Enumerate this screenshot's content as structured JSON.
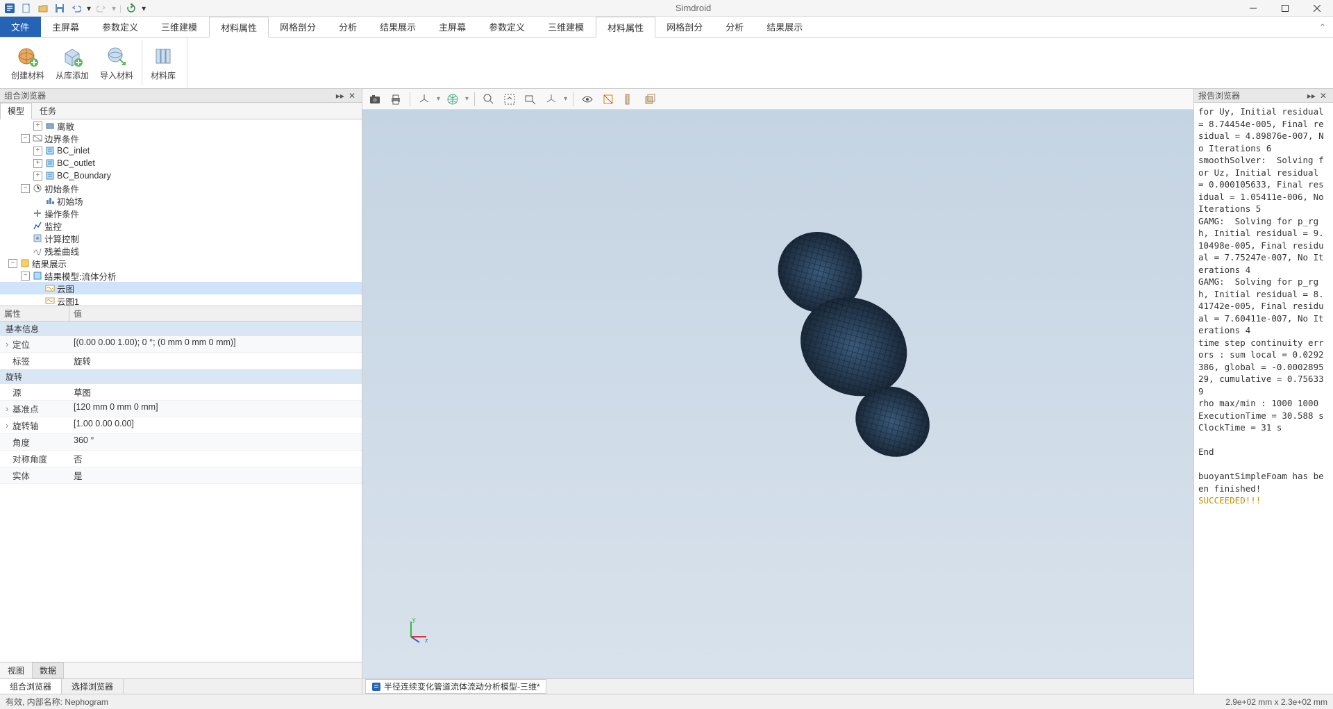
{
  "title": "Simdroid",
  "menu": {
    "file": "文件",
    "tabs": [
      "主屏幕",
      "参数定义",
      "三维建模",
      "材料属性",
      "网格剖分",
      "分析",
      "结果展示"
    ],
    "active_index": 3
  },
  "ribbon": {
    "buttons": [
      {
        "label": "创建材料",
        "icon": "sphere-plus"
      },
      {
        "label": "从库添加",
        "icon": "cube-plus"
      },
      {
        "label": "导入材料",
        "icon": "sphere-import"
      },
      {
        "label": "材料库",
        "icon": "library"
      }
    ]
  },
  "left": {
    "pane_title": "组合浏览器",
    "tree_tabs": [
      "模型",
      "任务"
    ],
    "tree_active": 0,
    "tree": [
      {
        "indent": 1,
        "toggle": "+",
        "icon": "node-blue",
        "label": "离散"
      },
      {
        "indent": 0,
        "toggle": "-",
        "icon": "boundary",
        "label": "边界条件"
      },
      {
        "indent": 1,
        "toggle": "+",
        "icon": "bc",
        "label": "BC_inlet"
      },
      {
        "indent": 1,
        "toggle": "+",
        "icon": "bc",
        "label": "BC_outlet"
      },
      {
        "indent": 1,
        "toggle": "+",
        "icon": "bc",
        "label": "BC_Boundary"
      },
      {
        "indent": 0,
        "toggle": "-",
        "icon": "init",
        "label": "初始条件"
      },
      {
        "indent": 1,
        "toggle": "",
        "icon": "field",
        "label": "初始场"
      },
      {
        "indent": 0,
        "toggle": "",
        "icon": "op",
        "label": "操作条件"
      },
      {
        "indent": 0,
        "toggle": "",
        "icon": "monitor",
        "label": "监控"
      },
      {
        "indent": 0,
        "toggle": "",
        "icon": "control",
        "label": "计算控制"
      },
      {
        "indent": 0,
        "toggle": "",
        "icon": "curve",
        "label": "残差曲线"
      },
      {
        "indent": -1,
        "toggle": "-",
        "icon": "result",
        "label": "结果展示"
      },
      {
        "indent": 0,
        "toggle": "-",
        "icon": "result-model",
        "label": "结果模型:流体分析"
      },
      {
        "indent": 1,
        "toggle": "",
        "icon": "cloud",
        "label": "云图",
        "selected": true
      },
      {
        "indent": 1,
        "toggle": "",
        "icon": "cloud",
        "label": "云图1"
      }
    ],
    "prop_header": [
      "属性",
      "值"
    ],
    "prop_sections": [
      {
        "title": "基本信息",
        "rows": [
          {
            "k": "定位",
            "v": "[(0.00 0.00 1.00); 0 °; (0 mm  0 mm  0 mm)]",
            "exp": true
          },
          {
            "k": "标签",
            "v": "旋转"
          }
        ]
      },
      {
        "title": "旋转",
        "rows": [
          {
            "k": "源",
            "v": "草图"
          },
          {
            "k": "基准点",
            "v": "[120 mm  0 mm  0 mm]",
            "exp": true
          },
          {
            "k": "旋转轴",
            "v": "[1.00 0.00 0.00]",
            "exp": true
          },
          {
            "k": "角度",
            "v": "360 °"
          },
          {
            "k": "对称角度",
            "v": "否"
          },
          {
            "k": "实体",
            "v": "是"
          }
        ]
      }
    ],
    "bottom_tabs1": [
      "视图",
      "数据"
    ],
    "bottom_tabs1_active": 1,
    "bottom_tabs2": [
      "组合浏览器",
      "选择浏览器"
    ],
    "bottom_tabs2_active": 0
  },
  "center": {
    "doc_tab": "半径连续变化管道流体流动分析模型-三维*"
  },
  "right": {
    "pane_title": "报告浏览器",
    "log_text": "for Uy, Initial residual = 8.74454e-005, Final residual = 4.89876e-007, No Iterations 6\nsmoothSolver:  Solving for Uz, Initial residual = 0.000105633, Final residual = 1.05411e-006, No Iterations 5\nGAMG:  Solving for p_rgh, Initial residual = 9.10498e-005, Final residual = 7.75247e-007, No Iterations 4\nGAMG:  Solving for p_rgh, Initial residual = 8.41742e-005, Final residual = 7.60411e-007, No Iterations 4\ntime step continuity errors : sum local = 0.0292386, global = -0.000289529, cumulative = 0.756339\nrho max/min : 1000 1000\nExecutionTime = 30.588 s  ClockTime = 31 s\n\nEnd\n\nbuoyantSimpleFoam has been finished!",
    "log_success": "SUCCEEDED!!!"
  },
  "status": {
    "left": "有效, 内部名称: Nephogram",
    "right": "2.9e+02 mm x 2.3e+02 mm"
  }
}
